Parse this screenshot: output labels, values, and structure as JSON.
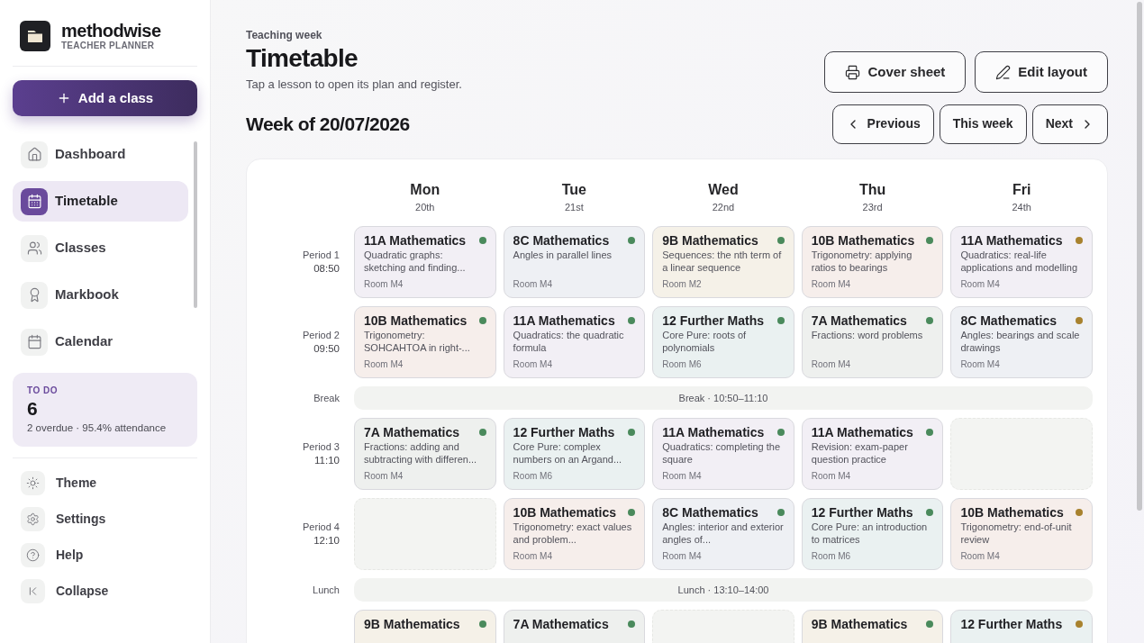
{
  "brand": {
    "name": "methodwise",
    "tagline": "TEACHER PLANNER"
  },
  "add_button": {
    "label": "Add a class"
  },
  "nav": [
    {
      "label": "Dashboard",
      "selected": false
    },
    {
      "label": "Timetable",
      "selected": true
    },
    {
      "label": "Classes",
      "selected": false
    },
    {
      "label": "Markbook",
      "selected": false
    },
    {
      "label": "Calendar",
      "selected": false
    }
  ],
  "todo": {
    "label": "TO DO",
    "count": "6",
    "detail": "2 overdue · 95.4% attendance"
  },
  "footer_nav": [
    {
      "label": "Theme"
    },
    {
      "label": "Settings"
    },
    {
      "label": "Help"
    },
    {
      "label": "Collapse"
    }
  ],
  "header": {
    "eyebrow": "Teaching week",
    "title": "Timetable",
    "subtitle": "Tap a lesson to open its plan and register."
  },
  "actions": [
    {
      "label": "Cover sheet"
    },
    {
      "label": "Edit layout"
    }
  ],
  "week": {
    "title": "Week of 20/07/2026",
    "nav": [
      {
        "label": "Previous",
        "kind": "prev"
      },
      {
        "label": "This week",
        "kind": "plain"
      },
      {
        "label": "Next",
        "kind": "next"
      }
    ]
  },
  "days": [
    {
      "name": "Mon",
      "date": "20th"
    },
    {
      "name": "Tue",
      "date": "21st"
    },
    {
      "name": "Wed",
      "date": "22nd"
    },
    {
      "name": "Thu",
      "date": "23rd"
    },
    {
      "name": "Fri",
      "date": "24th"
    }
  ],
  "rows": [
    {
      "kind": "period",
      "label": "Period 1",
      "time": "08:50",
      "lessons": [
        {
          "kind": "year11",
          "class": "11A Mathematics",
          "topic": "Quadratic graphs: sketching and finding...",
          "room": "Room M4",
          "color": "#4a8a5c"
        },
        {
          "kind": "year8",
          "class": "8C Mathematics",
          "topic": "Angles in parallel lines",
          "room": "Room M4",
          "color": "#4a8a5c"
        },
        {
          "kind": "year9",
          "class": "9B Mathematics",
          "topic": "Sequences: the nth term of a linear sequence",
          "room": "Room M2",
          "color": "#4a8a5c"
        },
        {
          "kind": "year10",
          "class": "10B Mathematics",
          "topic": "Trigonometry: applying ratios to bearings",
          "room": "Room M4",
          "color": "#4a8a5c"
        },
        {
          "kind": "year11",
          "class": "11A Mathematics",
          "topic": "Quadratics: real-life applications and modelling",
          "room": "Room M4",
          "color": "#a8822e"
        }
      ]
    },
    {
      "kind": "period",
      "label": "Period 2",
      "time": "09:50",
      "lessons": [
        {
          "kind": "year10",
          "class": "10B Mathematics",
          "topic": "Trigonometry: SOHCAHTOA in right-...",
          "room": "Room M4",
          "color": "#4a8a5c"
        },
        {
          "kind": "year11",
          "class": "11A Mathematics",
          "topic": "Quadratics: the quadratic formula",
          "room": "Room M4",
          "color": "#4a8a5c"
        },
        {
          "kind": "year12",
          "class": "12 Further Maths",
          "topic": "Core Pure: roots of polynomials",
          "room": "Room M6",
          "color": "#4a8a5c"
        },
        {
          "kind": "year7",
          "class": "7A Mathematics",
          "topic": "Fractions: word problems",
          "room": "Room M4",
          "color": "#4a8a5c"
        },
        {
          "kind": "year8",
          "class": "8C Mathematics",
          "topic": "Angles: bearings and scale drawings",
          "room": "Room M4",
          "color": "#a8822e"
        }
      ]
    },
    {
      "kind": "break",
      "label": "Break",
      "text": "Break · 10:50–11:10"
    },
    {
      "kind": "period",
      "label": "Period 3",
      "time": "11:10",
      "lessons": [
        {
          "kind": "year7",
          "class": "7A Mathematics",
          "topic": "Fractions: adding and subtracting with differen...",
          "room": "Room M4",
          "color": "#4a8a5c"
        },
        {
          "kind": "year12",
          "class": "12 Further Maths",
          "topic": "Core Pure: complex numbers on an Argand...",
          "room": "Room M6",
          "color": "#4a8a5c"
        },
        {
          "kind": "year11",
          "class": "11A Mathematics",
          "topic": "Quadratics: completing the square",
          "room": "Room M4",
          "color": "#4a8a5c"
        },
        {
          "kind": "year11",
          "class": "11A Mathematics",
          "topic": "Revision: exam-paper question practice",
          "room": "Room M4",
          "color": "#4a8a5c"
        },
        {
          "kind": "free"
        }
      ]
    },
    {
      "kind": "period",
      "label": "Period 4",
      "time": "12:10",
      "lessons": [
        {
          "kind": "free"
        },
        {
          "kind": "year10",
          "class": "10B Mathematics",
          "topic": "Trigonometry: exact values and problem...",
          "room": "Room M4",
          "color": "#4a8a5c"
        },
        {
          "kind": "year8",
          "class": "8C Mathematics",
          "topic": "Angles: interior and exterior angles of...",
          "room": "Room M4",
          "color": "#4a8a5c"
        },
        {
          "kind": "year12",
          "class": "12 Further Maths",
          "topic": "Core Pure: an introduction to matrices",
          "room": "Room M6",
          "color": "#4a8a5c"
        },
        {
          "kind": "year10",
          "class": "10B Mathematics",
          "topic": "Trigonometry: end-of-unit review",
          "room": "Room M4",
          "color": "#a8822e"
        }
      ]
    },
    {
      "kind": "break",
      "label": "Lunch",
      "text": "Lunch · 13:10–14:00"
    },
    {
      "kind": "period",
      "lessons": [
        {
          "kind": "year9",
          "class": "9B Mathematics",
          "color": "#4a8a5c"
        },
        {
          "kind": "year7",
          "class": "7A Mathematics",
          "color": "#4a8a5c"
        },
        {
          "kind": "free"
        },
        {
          "kind": "year9",
          "class": "9B Mathematics",
          "color": "#4a8a5c"
        },
        {
          "kind": "year12",
          "class": "12 Further Maths",
          "color": "#a8822e"
        }
      ]
    }
  ]
}
